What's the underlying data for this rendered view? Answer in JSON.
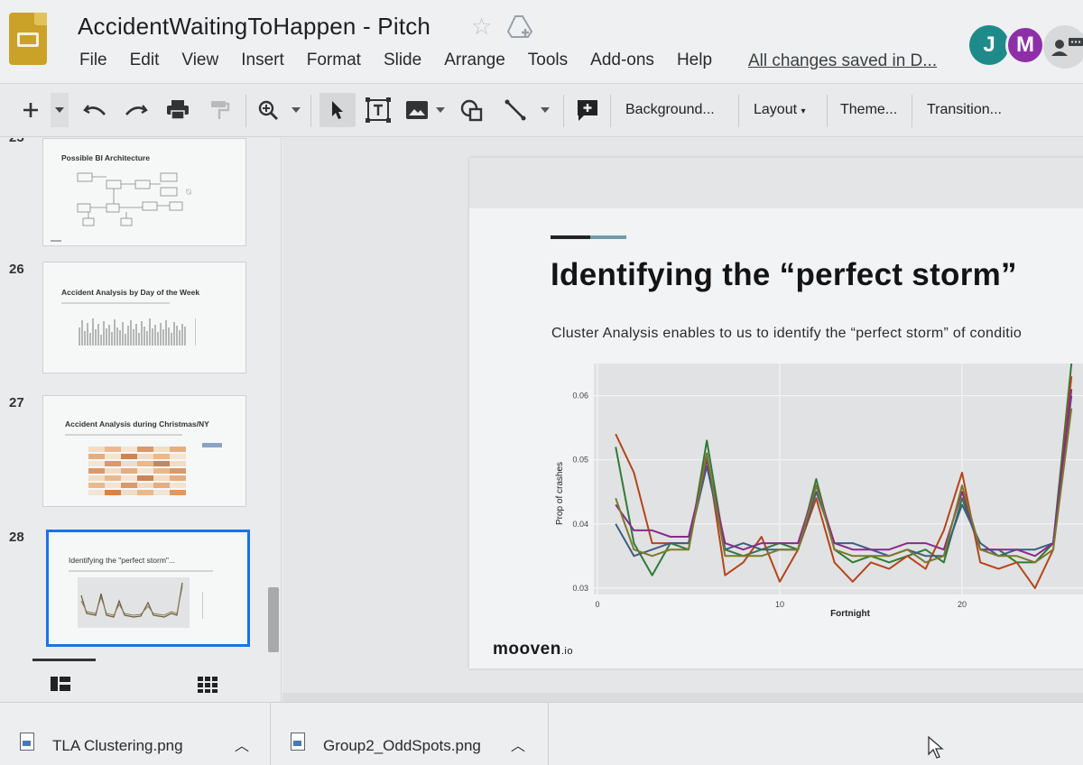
{
  "header": {
    "doc_title": "AccidentWaitingToHappen - Pitch",
    "menu": [
      "File",
      "Edit",
      "View",
      "Insert",
      "Format",
      "Slide",
      "Arrange",
      "Tools",
      "Add-ons",
      "Help"
    ],
    "save_status": "All changes saved in D...",
    "avatars": [
      "J",
      "M"
    ]
  },
  "toolbar": {
    "background_label": "Background...",
    "layout_label": "Layout",
    "theme_label": "Theme...",
    "transition_label": "Transition..."
  },
  "filmstrip": {
    "partial_number": "25",
    "slides": [
      {
        "number": "",
        "title": "Possible BI Architecture"
      },
      {
        "number": "26",
        "title": "Accident Analysis by Day of the Week"
      },
      {
        "number": "27",
        "title": "Accident Analysis during Christmas/NY"
      },
      {
        "number": "28",
        "title": "Identifying the \"perfect storm\"..."
      }
    ],
    "selected_slide": "28"
  },
  "slide": {
    "title": "Identifying the “perfect storm”",
    "subtitle": "Cluster Analysis enables to us to identify the “perfect storm” of conditio",
    "brand": "mooven",
    "brand_suffix": ".io"
  },
  "chart_data": {
    "type": "line",
    "xlabel": "Fortnight",
    "ylabel": "Prop of crashes",
    "xlim": [
      0,
      26
    ],
    "ylim": [
      0.029,
      0.065
    ],
    "xticks": [
      0,
      10,
      20
    ],
    "yticks": [
      0.03,
      0.04,
      0.05,
      0.06
    ],
    "x": [
      1,
      2,
      3,
      4,
      5,
      6,
      7,
      8,
      9,
      10,
      11,
      12,
      13,
      14,
      15,
      16,
      17,
      18,
      19,
      20,
      21,
      22,
      23,
      24,
      25,
      26
    ],
    "series": [
      {
        "color": "#2f7a3a",
        "values": [
          0.052,
          0.037,
          0.032,
          0.037,
          0.036,
          0.053,
          0.036,
          0.035,
          0.036,
          0.037,
          0.036,
          0.047,
          0.036,
          0.034,
          0.035,
          0.034,
          0.035,
          0.036,
          0.034,
          0.044,
          0.036,
          0.036,
          0.034,
          0.034,
          0.037,
          0.066
        ]
      },
      {
        "color": "#b5451b",
        "values": [
          0.054,
          0.048,
          0.037,
          0.037,
          0.037,
          0.051,
          0.032,
          0.034,
          0.038,
          0.031,
          0.036,
          0.044,
          0.034,
          0.031,
          0.034,
          0.033,
          0.035,
          0.033,
          0.039,
          0.048,
          0.034,
          0.033,
          0.034,
          0.03,
          0.036,
          0.063
        ]
      },
      {
        "color": "#3b5f82",
        "values": [
          0.04,
          0.035,
          0.036,
          0.037,
          0.037,
          0.049,
          0.036,
          0.037,
          0.036,
          0.036,
          0.036,
          0.045,
          0.037,
          0.037,
          0.036,
          0.035,
          0.036,
          0.035,
          0.035,
          0.043,
          0.037,
          0.035,
          0.036,
          0.036,
          0.037,
          0.06
        ]
      },
      {
        "color": "#8a2a8a",
        "values": [
          0.043,
          0.039,
          0.039,
          0.038,
          0.038,
          0.05,
          0.037,
          0.036,
          0.037,
          0.037,
          0.037,
          0.046,
          0.037,
          0.036,
          0.036,
          0.036,
          0.037,
          0.037,
          0.036,
          0.045,
          0.036,
          0.036,
          0.036,
          0.035,
          0.037,
          0.061
        ]
      },
      {
        "color": "#7a7a2a",
        "values": [
          0.044,
          0.036,
          0.035,
          0.036,
          0.036,
          0.051,
          0.035,
          0.035,
          0.035,
          0.036,
          0.036,
          0.046,
          0.036,
          0.035,
          0.035,
          0.035,
          0.036,
          0.034,
          0.035,
          0.046,
          0.036,
          0.035,
          0.035,
          0.034,
          0.036,
          0.058
        ]
      }
    ]
  },
  "downloads": [
    {
      "name": "TLA Clustering.png"
    },
    {
      "name": "Group2_OddSpots.png"
    }
  ]
}
